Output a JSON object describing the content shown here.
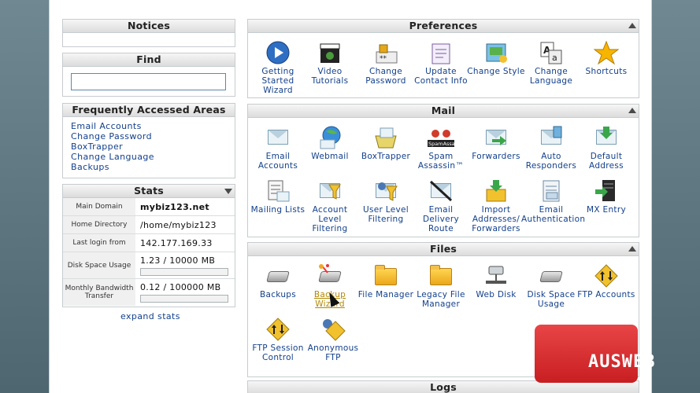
{
  "notices": {
    "title": "Notices"
  },
  "find": {
    "title": "Find",
    "value": ""
  },
  "faa": {
    "title": "Frequently Accessed Areas",
    "links": [
      "Email Accounts",
      "Change Password",
      "BoxTrapper",
      "Change Language",
      "Backups"
    ]
  },
  "stats": {
    "title": "Stats",
    "rows": [
      {
        "label": "Main Domain",
        "value": "mybiz123.net"
      },
      {
        "label": "Home Directory",
        "value": "/home/mybiz123"
      },
      {
        "label": "Last login from",
        "value": "142.177.169.33"
      },
      {
        "label": "Disk Space Usage",
        "value": "1.23 / 10000 MB",
        "usage": 0.0001
      },
      {
        "label": "Monthly Bandwidth Transfer",
        "value": "0.12 / 100000 MB",
        "usage": 1.2e-06
      }
    ],
    "expand": "expand stats"
  },
  "preferences": {
    "title": "Preferences",
    "items": [
      {
        "label": "Getting Started Wizard",
        "icon": "play-icon"
      },
      {
        "label": "Video Tutorials",
        "icon": "clapperboard-icon"
      },
      {
        "label": "Change Password",
        "icon": "password-lock-icon"
      },
      {
        "label": "Update Contact Info",
        "icon": "contact-info-icon"
      },
      {
        "label": "Change Style",
        "icon": "style-icon"
      },
      {
        "label": "Change Language",
        "icon": "language-icon"
      },
      {
        "label": "Shortcuts",
        "icon": "star-icon"
      }
    ]
  },
  "mail": {
    "title": "Mail",
    "items": [
      {
        "label": "Email Accounts",
        "icon": "envelope-icon"
      },
      {
        "label": "Webmail",
        "icon": "webmail-icon"
      },
      {
        "label": "BoxTrapper",
        "icon": "boxtrapper-icon"
      },
      {
        "label": "Spam Assassin™",
        "icon": "spamassassin-icon",
        "badge": "SpamAssassin"
      },
      {
        "label": "Forwarders",
        "icon": "forwarders-icon"
      },
      {
        "label": "Auto Responders",
        "icon": "auto-responders-icon"
      },
      {
        "label": "Default Address",
        "icon": "default-address-icon"
      },
      {
        "label": "Mailing Lists",
        "icon": "mailing-lists-icon"
      },
      {
        "label": "Account Level Filtering",
        "icon": "account-filter-icon"
      },
      {
        "label": "User Level Filtering",
        "icon": "user-filter-icon"
      },
      {
        "label": "Email Delivery Route",
        "icon": "delivery-route-icon"
      },
      {
        "label": "Import Addresses/ Forwarders",
        "icon": "import-icon"
      },
      {
        "label": "Email Authentication",
        "icon": "email-auth-icon"
      },
      {
        "label": "MX Entry",
        "icon": "mx-entry-icon"
      }
    ]
  },
  "files": {
    "title": "Files",
    "items": [
      {
        "label": "Backups",
        "icon": "disk-icon"
      },
      {
        "label": "Backup Wizard",
        "icon": "backup-wizard-icon"
      },
      {
        "label": "File Manager",
        "icon": "folder-icon"
      },
      {
        "label": "Legacy File Manager",
        "icon": "legacy-folder-icon"
      },
      {
        "label": "Web Disk",
        "icon": "web-disk-icon"
      },
      {
        "label": "Disk Space Usage",
        "icon": "disk-usage-icon"
      },
      {
        "label": "FTP Accounts",
        "icon": "ftp-icon"
      },
      {
        "label": "FTP Session Control",
        "icon": "ftp-session-icon"
      },
      {
        "label": "Anonymous FTP",
        "icon": "anonymous-ftp-icon"
      }
    ]
  },
  "logs": {
    "title": "Logs"
  },
  "watermark": {
    "text": "AUSWEB"
  },
  "colors": {
    "link": "#12408b",
    "accent": "#c81e22",
    "highlight": "#b48800"
  }
}
